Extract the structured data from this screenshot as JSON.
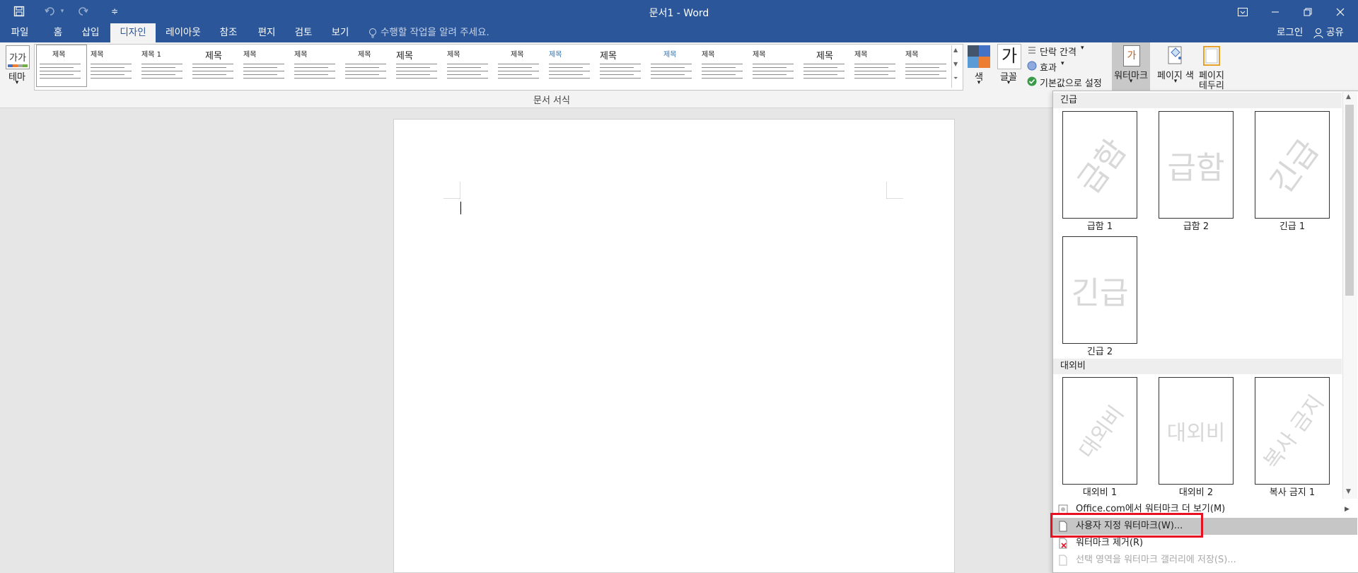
{
  "title_bar": {
    "doc_title": "문서1 - Word",
    "customize_glyph": "≑"
  },
  "tabs": [
    "파일",
    "홈",
    "삽입",
    "디자인",
    "레이아웃",
    "참조",
    "편지",
    "검토",
    "보기"
  ],
  "active_tab": "디자인",
  "tell_me": "수행할 작업을 알려 주세요.",
  "account": {
    "login": "로그인",
    "share": "공유"
  },
  "ribbon": {
    "theme_label": "테마",
    "theme_icon_text": "가가",
    "group_label": "문서 서식",
    "style_titles": [
      "제목",
      "제목",
      "제목 1",
      "제목",
      "제목",
      "제목",
      "제목",
      "제목",
      "제목",
      "제목",
      "제목",
      "제목",
      "제목",
      "제목",
      "제목",
      "제목",
      "제목",
      "제목"
    ],
    "colors_label": "색",
    "fonts_label": "글꼴",
    "fonts_icon_text": "가",
    "paragraph_spacing": "단락 간격",
    "effects": "효과",
    "set_default": "기본값으로 설정",
    "watermark_label": "워터마크",
    "watermark_icon_text": "가",
    "page_color_label_1": "페이지",
    "page_color_label_2": "색",
    "page_borders_label_1": "페이지",
    "page_borders_label_2": "테두리"
  },
  "watermark_panel": {
    "sections": [
      {
        "header": "긴급",
        "items": [
          {
            "label": "급함 1",
            "text": "급함",
            "style": "diagonal"
          },
          {
            "label": "급함 2",
            "text": "급함",
            "style": "horizontal"
          },
          {
            "label": "긴급 1",
            "text": "긴급",
            "style": "diagonal"
          },
          {
            "label": "긴급 2",
            "text": "긴급",
            "style": "horizontal"
          }
        ]
      },
      {
        "header": "대외비",
        "items": [
          {
            "label": "대외비 1",
            "text": "대외비",
            "style": "diagonal"
          },
          {
            "label": "대외비 2",
            "text": "대외비",
            "style": "horizontal"
          },
          {
            "label": "복사 금지 1",
            "text": "복사 금지",
            "style": "diagonal"
          }
        ]
      }
    ],
    "menu": {
      "more_from_office": "Office.com에서 워터마크 더 보기(M)",
      "custom_watermark": "사용자 지정 워터마크(W)...",
      "remove_watermark": "워터마크 제거(R)",
      "save_selection": "선택 영역을 워터마크 갤러리에 저장(S)..."
    }
  },
  "colors": {
    "brand": "#2b579a",
    "highlight_box": "#e81123"
  }
}
